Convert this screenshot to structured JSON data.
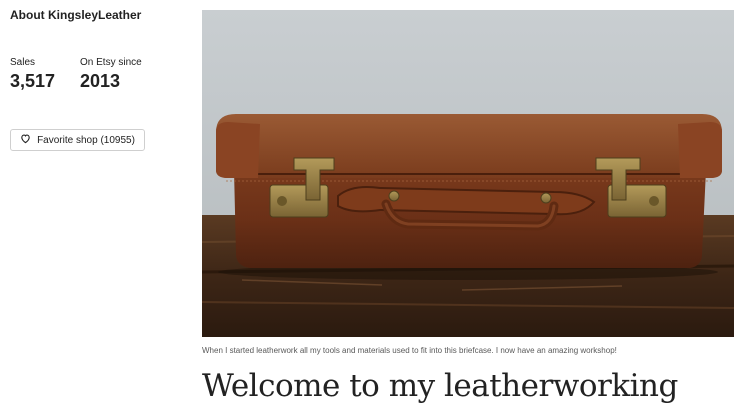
{
  "about": {
    "title": "About KingsleyLeather"
  },
  "stats": {
    "sales_label": "Sales",
    "sales_value": "3,517",
    "since_label": "On Etsy since",
    "since_value": "2013"
  },
  "favorite": {
    "icon": "heart-icon",
    "label": "Favorite shop (10955)"
  },
  "photo": {
    "caption": "When I started leatherwork all my tools and materials used to fit into this briefcase. I now have an amazing workshop!"
  },
  "story": {
    "heading": "Welcome to my leatherworking"
  }
}
